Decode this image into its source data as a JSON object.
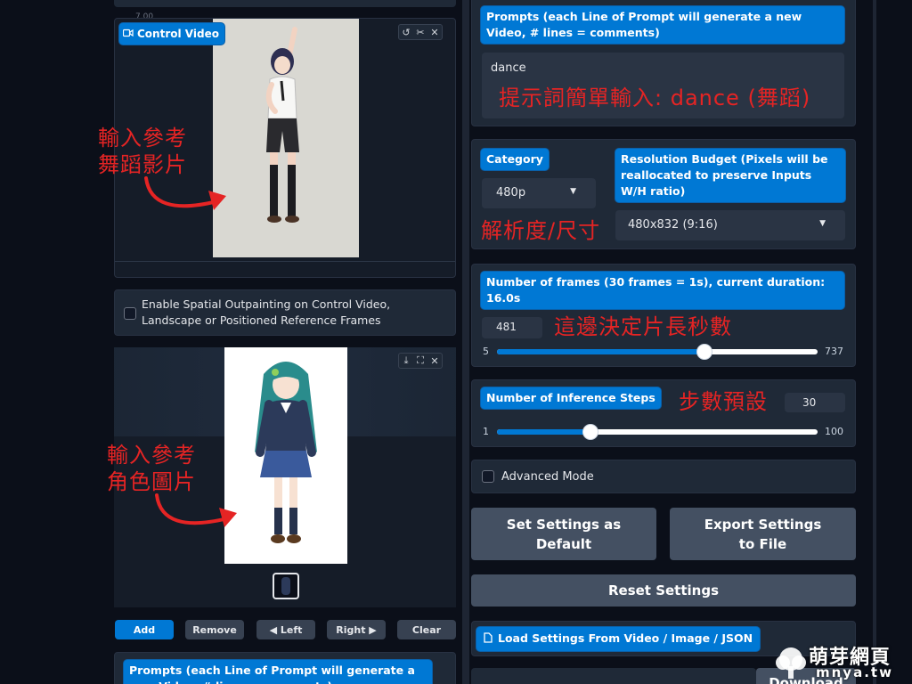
{
  "left_top_ruler": "7.00",
  "control_video": {
    "label": "Control Video",
    "icons": [
      "reset-icon",
      "scissors-icon",
      "close-icon"
    ]
  },
  "annotations": {
    "ref_video": "輸入參考\n舞蹈影片",
    "ref_character": "輸入參考\n角色圖片",
    "prompt_hint": "提示詞簡單輸入: dance (舞蹈)",
    "resolution_hint": "解析度/尺寸",
    "frames_hint": "這邊決定片長秒數",
    "steps_hint": "步數預設"
  },
  "spatial_outpainting": {
    "label": "Enable Spatial Outpainting on Control Video, Landscape or Positioned Reference Frames",
    "checked": false
  },
  "ref_image_icons": [
    "download-icon",
    "fullscreen-icon",
    "close-icon"
  ],
  "gallery_buttons": {
    "add": "Add",
    "remove": "Remove",
    "left": "◀ Left",
    "right": "Right ▶",
    "clear": "Clear"
  },
  "bottom_prompt_label": "Prompts (each Line of Prompt will generate a new Video, # lines = comments)",
  "prompts": {
    "label": "Prompts (each Line of Prompt will generate a new Video, # lines = comments)",
    "value": "dance"
  },
  "category": {
    "label": "Category",
    "selected": "480p"
  },
  "resolution": {
    "label": "Resolution Budget (Pixels will be reallocated to preserve Inputs W/H ratio)",
    "selected": "480x832 (9:16)"
  },
  "frames": {
    "label": "Number of frames (30 frames = 1s), current duration: 16.0s",
    "value": "481",
    "min": "5",
    "max": "737",
    "fraction": 0.646
  },
  "steps": {
    "label": "Number of Inference Steps",
    "value": "30",
    "min": "1",
    "max": "100",
    "fraction": 0.293
  },
  "advanced_mode": {
    "label": "Advanced Mode",
    "checked": false
  },
  "settings_buttons": {
    "set_default": "Set Settings as Default",
    "export": "Export Settings to File",
    "reset": "Reset Settings"
  },
  "load_settings": {
    "label": "Load Settings From Video / Image / JSON"
  },
  "bottom_right": {
    "download": "Download"
  },
  "watermark": {
    "text": "萌芽網頁",
    "sub": "mnya.tw"
  },
  "colors": {
    "accent": "#0078d4",
    "annotation": "#e52424",
    "background": "#0b0f19",
    "panel": "#1f2937"
  }
}
